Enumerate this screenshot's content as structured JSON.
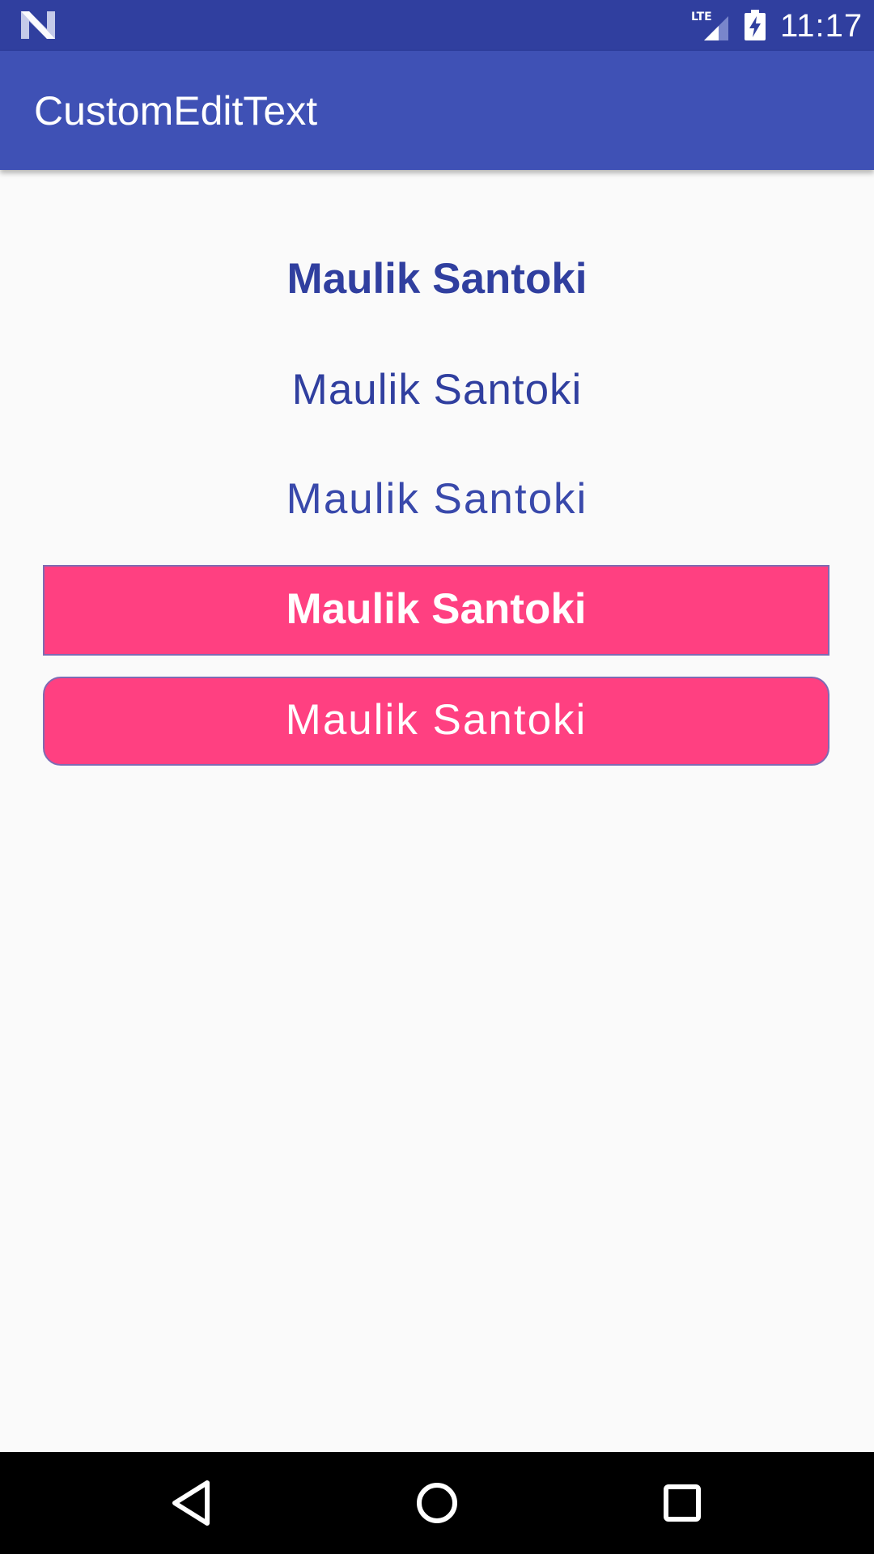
{
  "status_bar": {
    "time": "11:17",
    "network_label": "LTE",
    "icons": [
      "notification-n-icon",
      "lte-signal-icon",
      "battery-charging-icon"
    ]
  },
  "app_bar": {
    "title": "CustomEditText"
  },
  "content": {
    "text_bold": "Maulik Santoki",
    "text_regular": "Maulik Santoki",
    "text_light": "Maulik Santoki",
    "edit_square_value": "Maulik Santoki",
    "edit_rounded_value": "Maulik Santoki"
  },
  "navigation": {
    "icons": [
      "back-icon",
      "home-icon",
      "recents-icon"
    ]
  },
  "colors": {
    "status_bar": "#303f9f",
    "app_bar": "#3f51b5",
    "text_primary": "#303f9f",
    "accent": "#ff4081",
    "background": "#fafafa",
    "nav_bar": "#000000"
  }
}
